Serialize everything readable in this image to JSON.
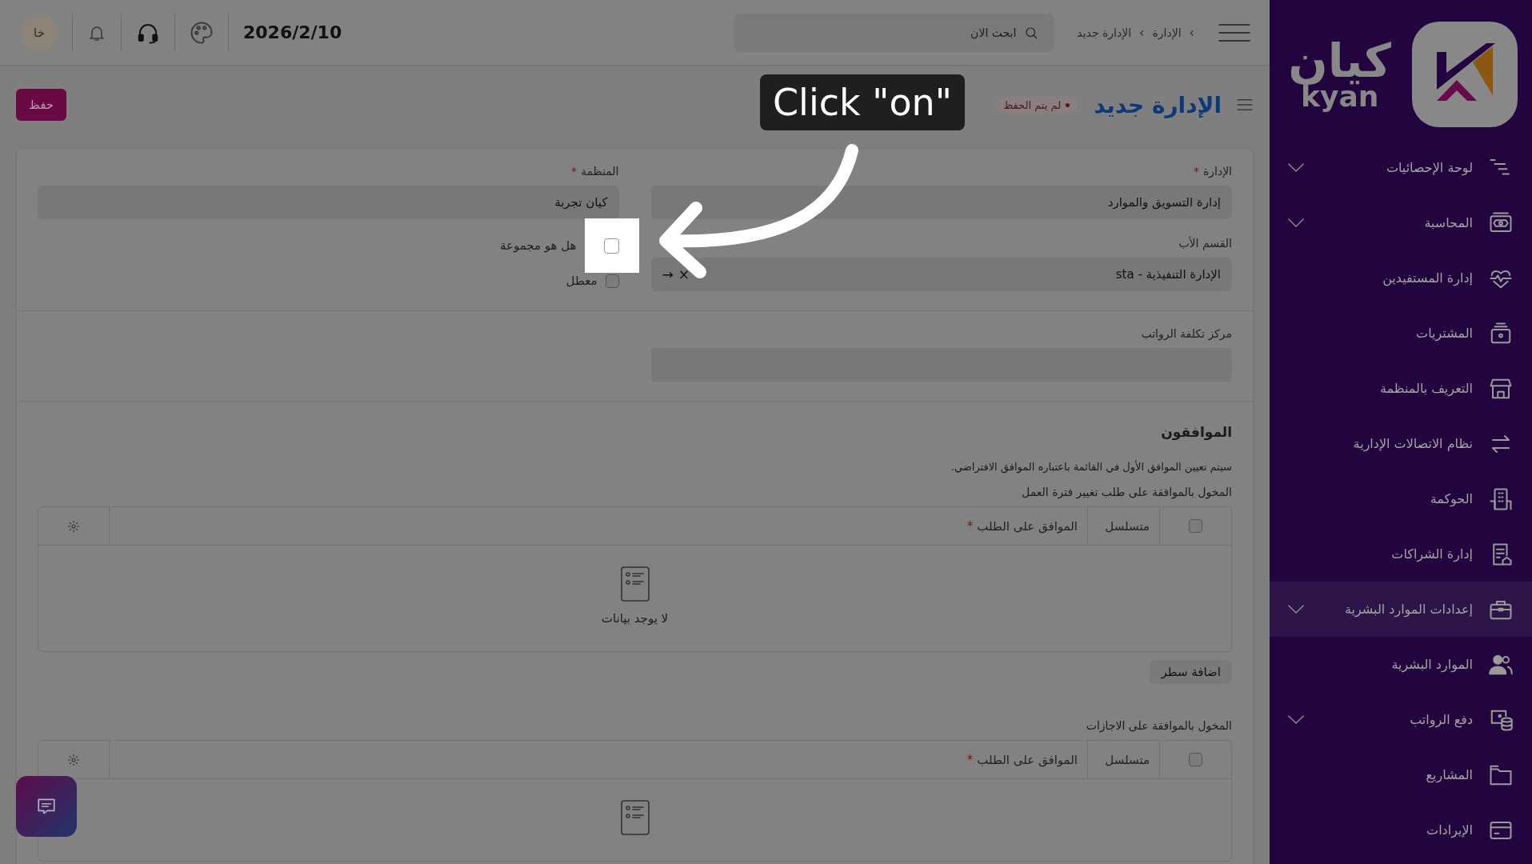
{
  "topbar": {
    "breadcrumb": [
      {
        "separator": "›",
        "label": "الإدارة"
      },
      {
        "separator": "›",
        "label": "الإدارة جديد"
      }
    ],
    "search": {
      "placeholder": "ابحث الان"
    },
    "date": "2026/2/10",
    "avatar": "خا"
  },
  "page": {
    "title": "الإدارة جديد",
    "status": "لم يتم الحفظ",
    "save_button": "حفظ"
  },
  "form": {
    "fields": [
      {
        "label": "الإدارة",
        "required_mark": "*",
        "value": "إدارة التسويق والموارد",
        "kind": "select"
      },
      {
        "label": "المنظمة",
        "required_mark": "*",
        "value": "كيان تجربة",
        "kind": "select"
      },
      {
        "label": "القسم الأب",
        "value": "الإدارة التنفيذية - sta",
        "kind": "link",
        "clear": "×",
        "open": "→"
      }
    ],
    "checkboxes": [
      {
        "label": "هل هو مجموعة",
        "checked": false
      },
      {
        "label": "معطل",
        "checked": false
      }
    ],
    "cost_center": {
      "label": "مركز تكلفة الرواتب"
    }
  },
  "approvers": {
    "title": "الموافقون",
    "note": "سيتم تعيين الموافق الأول في القائمة باعتباره الموافق الافتراضي.",
    "tables": [
      {
        "label": "المخول بالموافقة على طلب تغيير فترة العمل",
        "header_checked": false,
        "columns": [
          {
            "label": "متسلسل"
          },
          {
            "label": "الموافق على الطلب",
            "required_mark": "*"
          }
        ],
        "empty_text": "لا يوجد بيانات",
        "add_button": "اضافة سطر"
      },
      {
        "label": "المخول بالموافقة على الاجازات",
        "header_checked": false,
        "columns": [
          {
            "label": "متسلسل"
          },
          {
            "label": "الموافق على الطلب",
            "required_mark": "*"
          }
        ]
      }
    ]
  },
  "sidebar": {
    "logo": {
      "arabic": "كيان",
      "latin": "kyan"
    },
    "items": [
      {
        "label": "لوحة الإحصائيات",
        "expandable": true,
        "selected": false
      },
      {
        "label": "المحاسبة",
        "expandable": true,
        "selected": false
      },
      {
        "label": "إدارة المستفيدين",
        "expandable": false,
        "selected": false
      },
      {
        "label": "المشتريات",
        "expandable": false,
        "selected": false
      },
      {
        "label": "التعريف بالمنظمة",
        "expandable": false,
        "selected": false
      },
      {
        "label": "نظام الاتصالات الإدارية",
        "expandable": false,
        "selected": false
      },
      {
        "label": "الحوكمة",
        "expandable": false,
        "selected": false
      },
      {
        "label": "إدارة الشراكات",
        "expandable": false,
        "selected": false
      },
      {
        "label": "إعدادات الموارد البشرية",
        "expandable": true,
        "selected": true
      },
      {
        "label": "الموارد البشرية",
        "expandable": false,
        "selected": false
      },
      {
        "label": "دفع الرواتب",
        "expandable": true,
        "selected": false
      },
      {
        "label": "المشاريع",
        "expandable": false,
        "selected": false
      },
      {
        "label": "الإيرادات",
        "expandable": false,
        "selected": false
      }
    ]
  },
  "tutorial": {
    "text": "Click \"on\""
  }
}
